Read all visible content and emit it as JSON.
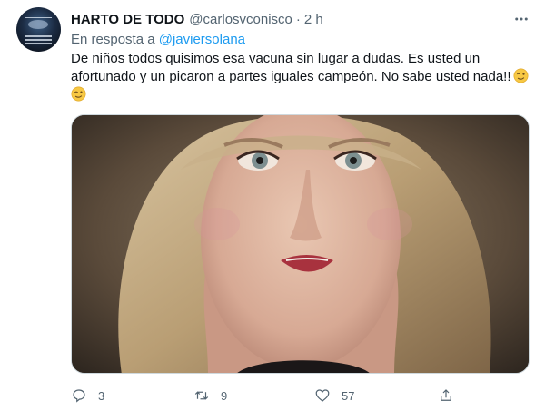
{
  "author": {
    "name": "HARTO DE TODO",
    "handle": "@carlosvconisco",
    "separator": "·",
    "time": "2 h",
    "avatar_text_top": "TRENECES A BASE",
    "avatar_text_bottom": "LA VERDAD PURA HOY LES"
  },
  "reply": {
    "prefix": "En resposta a",
    "mention": "@javiersolana"
  },
  "tweet": {
    "text": "De niños todos quisimos esa vacuna sin lugar a dudas. Es usted un afortunado y un picaron a partes iguales campeón. No sabe usted nada!!"
  },
  "actions": {
    "reply_count": "3",
    "retweet_count": "9",
    "like_count": "57"
  },
  "icons": [
    "more-icon",
    "reply-icon",
    "retweet-icon",
    "like-icon",
    "share-icon",
    "wink-emoji-icon"
  ],
  "colors": {
    "link": "#1d9bf0",
    "muted": "#536471",
    "text": "#0f1419",
    "border": "#cfd9de"
  }
}
